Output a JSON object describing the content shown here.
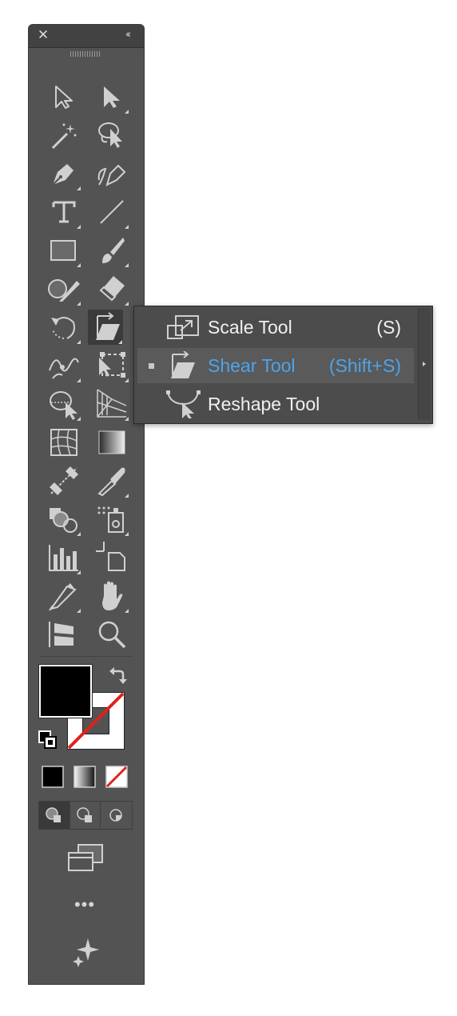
{
  "panel": {
    "close_glyph": "✕",
    "collapse_glyph": "‹‹"
  },
  "tools": [
    {
      "name": "selection-tool-icon"
    },
    {
      "name": "direct-selection-tool-icon"
    },
    {
      "name": "magic-wand-tool-icon"
    },
    {
      "name": "lasso-tool-icon"
    },
    {
      "name": "pen-tool-icon"
    },
    {
      "name": "curvature-tool-icon"
    },
    {
      "name": "type-tool-icon"
    },
    {
      "name": "line-segment-tool-icon"
    },
    {
      "name": "rectangle-tool-icon"
    },
    {
      "name": "paintbrush-tool-icon"
    },
    {
      "name": "shaper-tool-icon"
    },
    {
      "name": "eraser-tool-icon"
    },
    {
      "name": "rotate-tool-icon"
    },
    {
      "name": "shear-tool-icon",
      "active": true
    },
    {
      "name": "width-tool-icon"
    },
    {
      "name": "free-transform-tool-icon"
    },
    {
      "name": "shape-builder-tool-icon"
    },
    {
      "name": "perspective-grid-tool-icon"
    },
    {
      "name": "mesh-tool-icon"
    },
    {
      "name": "gradient-tool-icon"
    },
    {
      "name": "blend-tool-icon"
    },
    {
      "name": "eyedropper-tool-icon"
    },
    {
      "name": "symbol-sprayer-tool-icon"
    },
    {
      "name": "live-paint-bucket-tool-icon"
    },
    {
      "name": "column-graph-tool-icon"
    },
    {
      "name": "artboard-tool-icon"
    },
    {
      "name": "slice-tool-icon"
    },
    {
      "name": "hand-tool-icon"
    },
    {
      "name": "puppet-warp-tool-icon"
    },
    {
      "name": "zoom-tool-icon"
    }
  ],
  "flyout": {
    "items": [
      {
        "label": "Scale Tool",
        "shortcut": "(S)",
        "selected": false
      },
      {
        "label": "Shear Tool",
        "shortcut": "(Shift+S)",
        "selected": true
      },
      {
        "label": "Reshape Tool",
        "shortcut": "",
        "selected": false
      }
    ]
  },
  "colors": {
    "panel": "#535353",
    "panel_header": "#424242",
    "selected_text": "#4da3ea",
    "fill": "#000000",
    "stroke_none_slash": "#e0211d"
  },
  "fill_stroke": {
    "fill_color": "#000000",
    "stroke": "none"
  },
  "more_label": "•••"
}
